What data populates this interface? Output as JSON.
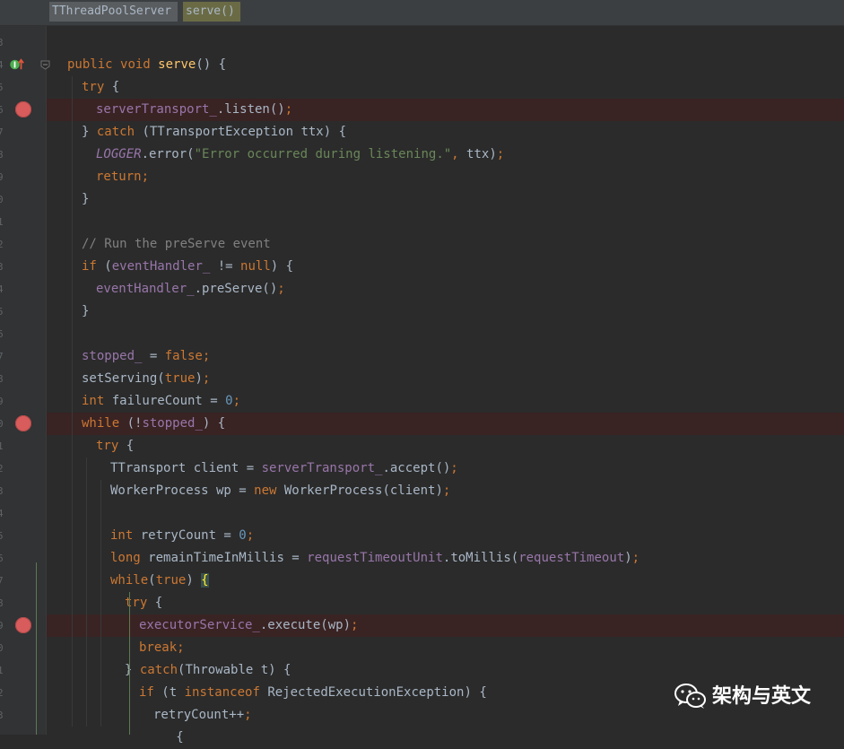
{
  "breadcrumb": {
    "class_name": "TThreadPoolServer",
    "method_name": "serve()"
  },
  "gutter": {
    "line_number_fragments": [
      "3",
      "4",
      "5",
      "6",
      "7",
      "8",
      "9",
      "0",
      "1",
      "2",
      "3",
      "4",
      "5",
      "6",
      "7",
      "8",
      "9",
      "0",
      "1",
      "2",
      "3",
      "4",
      "5",
      "6",
      "7",
      "8",
      "9",
      "0",
      "1",
      "2",
      "3"
    ],
    "breakpoint_lines": [
      3,
      17,
      26
    ],
    "override_icon": "override-implements-icon"
  },
  "code_lines": [
    {
      "indent": 0,
      "tokens": []
    },
    {
      "indent": 0,
      "tokens": [
        [
          "kw",
          "public "
        ],
        [
          "kw",
          "void "
        ],
        [
          "fn",
          "serve"
        ],
        [
          "plain",
          "() {"
        ]
      ]
    },
    {
      "indent": 1,
      "tokens": [
        [
          "kw",
          "try "
        ],
        [
          "plain",
          "{"
        ]
      ]
    },
    {
      "indent": 2,
      "tokens": [
        [
          "field",
          "serverTransport_"
        ],
        [
          "plain",
          ".listen()"
        ],
        [
          "punc",
          ";"
        ]
      ]
    },
    {
      "indent": 1,
      "tokens": [
        [
          "plain",
          "} "
        ],
        [
          "kw",
          "catch "
        ],
        [
          "plain",
          "(TTransportException ttx) {"
        ]
      ]
    },
    {
      "indent": 2,
      "tokens": [
        [
          "static",
          "LOGGER"
        ],
        [
          "plain",
          ".error("
        ],
        [
          "str",
          "\"Error occurred during listening.\""
        ],
        [
          "punc",
          ", "
        ],
        [
          "plain",
          "ttx)"
        ],
        [
          "punc",
          ";"
        ]
      ]
    },
    {
      "indent": 2,
      "tokens": [
        [
          "kw",
          "return"
        ],
        [
          "punc",
          ";"
        ]
      ]
    },
    {
      "indent": 1,
      "tokens": [
        [
          "plain",
          "}"
        ]
      ]
    },
    {
      "indent": 0,
      "tokens": []
    },
    {
      "indent": 1,
      "tokens": [
        [
          "cmt",
          "// Run the preServe event"
        ]
      ]
    },
    {
      "indent": 1,
      "tokens": [
        [
          "kw",
          "if "
        ],
        [
          "plain",
          "("
        ],
        [
          "field",
          "eventHandler_ "
        ],
        [
          "plain",
          "!= "
        ],
        [
          "kw",
          "null"
        ],
        [
          "plain",
          ") {"
        ]
      ]
    },
    {
      "indent": 2,
      "tokens": [
        [
          "field",
          "eventHandler_"
        ],
        [
          "plain",
          ".preServe()"
        ],
        [
          "punc",
          ";"
        ]
      ]
    },
    {
      "indent": 1,
      "tokens": [
        [
          "plain",
          "}"
        ]
      ]
    },
    {
      "indent": 0,
      "tokens": []
    },
    {
      "indent": 1,
      "tokens": [
        [
          "field",
          "stopped_ "
        ],
        [
          "plain",
          "= "
        ],
        [
          "kw",
          "false"
        ],
        [
          "punc",
          ";"
        ]
      ]
    },
    {
      "indent": 1,
      "tokens": [
        [
          "plain",
          "setServing("
        ],
        [
          "kw",
          "true"
        ],
        [
          "plain",
          ")"
        ],
        [
          "punc",
          ";"
        ]
      ]
    },
    {
      "indent": 1,
      "tokens": [
        [
          "kw",
          "int "
        ],
        [
          "plain",
          "failureCount = "
        ],
        [
          "num",
          "0"
        ],
        [
          "punc",
          ";"
        ]
      ]
    },
    {
      "indent": 1,
      "tokens": [
        [
          "kw",
          "while "
        ],
        [
          "plain",
          "(!"
        ],
        [
          "field",
          "stopped_"
        ],
        [
          "plain",
          ") {"
        ]
      ]
    },
    {
      "indent": 2,
      "tokens": [
        [
          "kw",
          "try "
        ],
        [
          "plain",
          "{"
        ]
      ]
    },
    {
      "indent": 3,
      "tokens": [
        [
          "plain",
          "TTransport client = "
        ],
        [
          "field",
          "serverTransport_"
        ],
        [
          "plain",
          ".accept()"
        ],
        [
          "punc",
          ";"
        ]
      ]
    },
    {
      "indent": 3,
      "tokens": [
        [
          "plain",
          "WorkerProcess wp = "
        ],
        [
          "kw",
          "new "
        ],
        [
          "plain",
          "WorkerProcess(client)"
        ],
        [
          "punc",
          ";"
        ]
      ]
    },
    {
      "indent": 0,
      "tokens": []
    },
    {
      "indent": 3,
      "tokens": [
        [
          "kw",
          "int "
        ],
        [
          "plain",
          "retryCount = "
        ],
        [
          "num",
          "0"
        ],
        [
          "punc",
          ";"
        ]
      ]
    },
    {
      "indent": 3,
      "tokens": [
        [
          "kw",
          "long "
        ],
        [
          "plain",
          "remainTimeInMillis = "
        ],
        [
          "field",
          "requestTimeoutUnit"
        ],
        [
          "plain",
          ".toMillis("
        ],
        [
          "field",
          "requestTimeout"
        ],
        [
          "plain",
          ")"
        ],
        [
          "punc",
          ";"
        ]
      ]
    },
    {
      "indent": 3,
      "tokens": [
        [
          "kw",
          "while"
        ],
        [
          "plain",
          "("
        ],
        [
          "kw",
          "true"
        ],
        [
          "plain",
          ") "
        ],
        [
          "bracehl",
          "{"
        ]
      ]
    },
    {
      "indent": 4,
      "tokens": [
        [
          "kw",
          "try "
        ],
        [
          "plain",
          "{"
        ]
      ]
    },
    {
      "indent": 5,
      "tokens": [
        [
          "field",
          "executorService_"
        ],
        [
          "plain",
          ".execute(wp)"
        ],
        [
          "punc",
          ";"
        ]
      ]
    },
    {
      "indent": 5,
      "tokens": [
        [
          "kw",
          "break"
        ],
        [
          "punc",
          ";"
        ]
      ]
    },
    {
      "indent": 4,
      "tokens": [
        [
          "plain",
          "} "
        ],
        [
          "kw",
          "catch"
        ],
        [
          "plain",
          "(Throwable t) {"
        ]
      ]
    },
    {
      "indent": 5,
      "tokens": [
        [
          "kw",
          "if "
        ],
        [
          "plain",
          "(t "
        ],
        [
          "kw",
          "instanceof "
        ],
        [
          "plain",
          "RejectedExecutionException) {"
        ]
      ]
    },
    {
      "indent": 6,
      "tokens": [
        [
          "plain",
          "retryCount++"
        ],
        [
          "punc",
          ";"
        ]
      ]
    },
    {
      "indent": 6,
      "tokens": [
        [
          "plain",
          "   {"
        ]
      ]
    }
  ],
  "watermark": {
    "icon": "wechat-icon",
    "text": "架构与英文"
  },
  "colors": {
    "background": "#2b2b2b",
    "gutter": "#313335",
    "keyword": "#cc7832",
    "method": "#ffc66d",
    "field": "#9876aa",
    "string": "#6a8759",
    "number": "#6897bb",
    "comment": "#808080",
    "breakpoint": "#d85c5c",
    "breakpoint_row": "#3a2323"
  }
}
